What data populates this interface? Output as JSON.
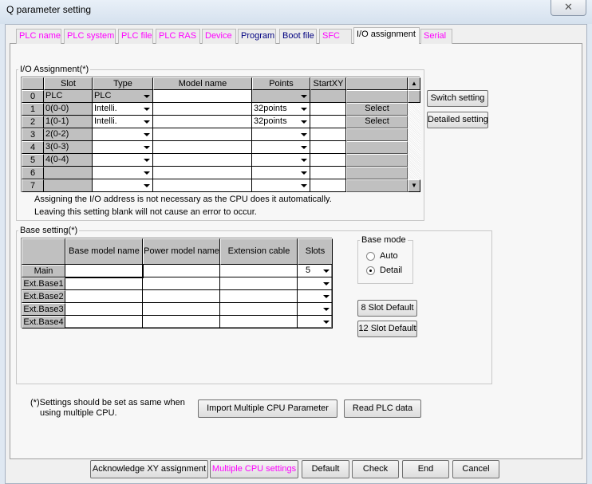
{
  "window": {
    "title": "Q parameter setting",
    "close_icon": "close-icon"
  },
  "tabs": [
    {
      "label": "PLC name",
      "color": "#ff00ff"
    },
    {
      "label": "PLC system",
      "color": "#ff00ff"
    },
    {
      "label": "PLC file",
      "color": "#ff00ff"
    },
    {
      "label": "PLC RAS",
      "color": "#ff00ff"
    },
    {
      "label": "Device",
      "color": "#ff00ff"
    },
    {
      "label": "Program",
      "color": "#000080"
    },
    {
      "label": "Boot file",
      "color": "#000080"
    },
    {
      "label": "SFC",
      "color": "#ff00ff"
    },
    {
      "label": "I/O assignment",
      "color": "#000000",
      "selected": true
    },
    {
      "label": "Serial",
      "color": "#ff00ff"
    }
  ],
  "io": {
    "legend": "I/O Assignment(*)",
    "headers": [
      "",
      "Slot",
      "Type",
      "Model name",
      "Points",
      "StartXY",
      ""
    ],
    "rows": [
      {
        "num": "0",
        "slot": "PLC",
        "type": "PLC",
        "model": "",
        "points": "",
        "startxy": "",
        "button": ""
      },
      {
        "num": "1",
        "slot": "0(0-0)",
        "type": "Intelli.",
        "model": "",
        "points": "32points",
        "startxy": "",
        "button": "Select"
      },
      {
        "num": "2",
        "slot": "1(0-1)",
        "type": "Intelli.",
        "model": "",
        "points": "32points",
        "startxy": "",
        "button": "Select"
      },
      {
        "num": "3",
        "slot": "2(0-2)",
        "type": "",
        "model": "",
        "points": "",
        "startxy": "",
        "button": ""
      },
      {
        "num": "4",
        "slot": "3(0-3)",
        "type": "",
        "model": "",
        "points": "",
        "startxy": "",
        "button": ""
      },
      {
        "num": "5",
        "slot": "4(0-4)",
        "type": "",
        "model": "",
        "points": "",
        "startxy": "",
        "button": ""
      },
      {
        "num": "6",
        "slot": "",
        "type": "",
        "model": "",
        "points": "",
        "startxy": "",
        "button": ""
      },
      {
        "num": "7",
        "slot": "",
        "type": "",
        "model": "",
        "points": "",
        "startxy": "",
        "button": ""
      }
    ],
    "note1": "Assigning the I/O address is not necessary as the CPU does it automatically.",
    "note2": "Leaving this setting blank will not cause an error to occur.",
    "switch_setting": "Switch setting",
    "detailed_setting": "Detailed setting"
  },
  "base": {
    "legend": "Base setting(*)",
    "headers": [
      "",
      "Base model name",
      "Power model name",
      "Extension cable",
      "Slots"
    ],
    "rows": [
      {
        "name": "Main",
        "slots": "5"
      },
      {
        "name": "Ext.Base1",
        "slots": ""
      },
      {
        "name": "Ext.Base2",
        "slots": ""
      },
      {
        "name": "Ext.Base3",
        "slots": ""
      },
      {
        "name": "Ext.Base4",
        "slots": ""
      }
    ],
    "mode_legend": "Base mode",
    "mode_auto": "Auto",
    "mode_detail": "Detail",
    "mode_selected": "Detail",
    "slot8": "8 Slot Default",
    "slot12": "12 Slot Default"
  },
  "footnote1": "(*)Settings should be set as same when",
  "footnote2": "using multiple CPU.",
  "import_button": "Import Multiple CPU Parameter",
  "read_button": "Read PLC data",
  "bottom": [
    {
      "label": "Acknowledge XY assignment",
      "color": "#000000"
    },
    {
      "label": "Multiple CPU settings",
      "color": "#ff00ff"
    },
    {
      "label": "Default",
      "color": "#000000"
    },
    {
      "label": "Check",
      "color": "#000000"
    },
    {
      "label": "End",
      "color": "#000000"
    },
    {
      "label": "Cancel",
      "color": "#000000"
    }
  ]
}
